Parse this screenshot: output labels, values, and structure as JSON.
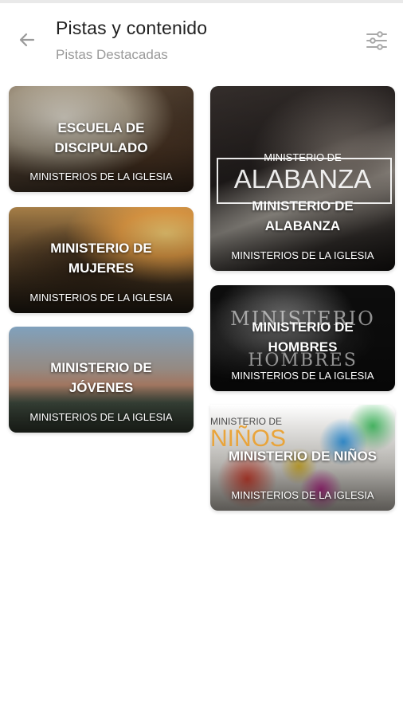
{
  "header": {
    "title": "Pistas y contenido",
    "subtitle": "Pistas Destacadas"
  },
  "icons": {
    "back": "back-arrow-icon",
    "filter": "sliders-icon"
  },
  "cards": [
    {
      "title": "ESCUELA DE DISCIPULADO",
      "subtitle": "MINISTERIOS DE LA IGLESIA"
    },
    {
      "title": "MINISTERIO DE MUJERES",
      "subtitle": "MINISTERIOS DE LA IGLESIA"
    },
    {
      "title": "MINISTERIO DE JÓVENES",
      "subtitle": "MINISTERIOS DE LA IGLESIA"
    },
    {
      "title": "MINISTERIO DE ALABANZA",
      "subtitle": "MINISTERIOS DE LA IGLESIA",
      "image_text_top": "MINISTERIO DE",
      "image_text_big": "ALABANZA"
    },
    {
      "title": "MINISTERIO DE HOMBRES",
      "subtitle": "MINISTERIOS DE LA IGLESIA",
      "image_text_top": "MINISTERIO",
      "image_text_big": "HOMBRES"
    },
    {
      "title": "MINISTERIO DE NIÑOS",
      "subtitle": "MINISTERIOS DE LA IGLESIA",
      "image_text_top": "MINISTERIO DE",
      "image_text_big": "NIÑOS"
    }
  ]
}
